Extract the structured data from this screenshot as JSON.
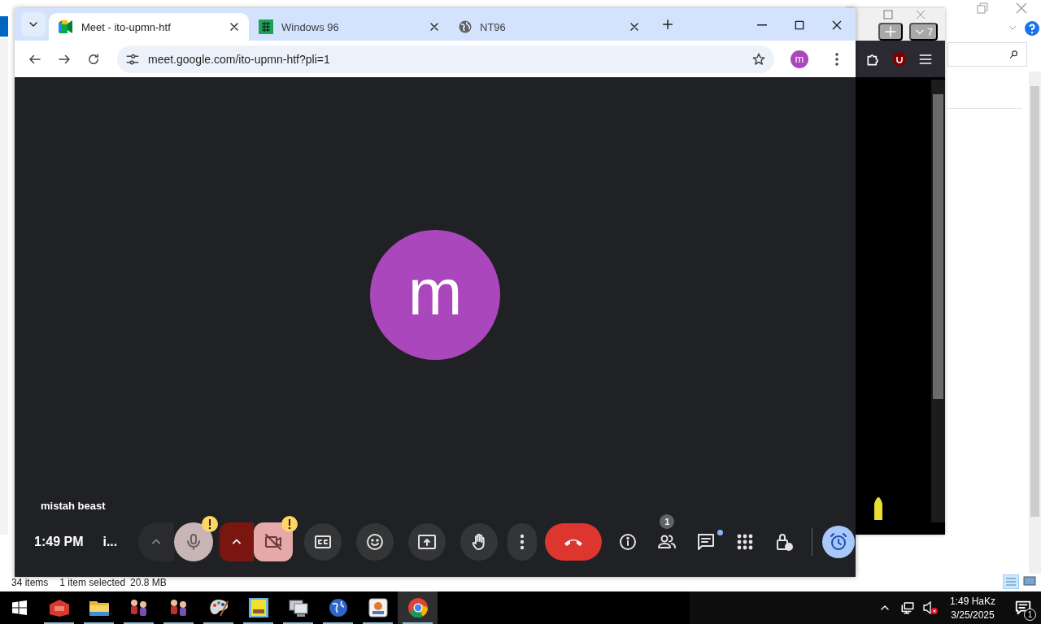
{
  "chrome_window": {
    "tabs": [
      {
        "title": "Meet - ito-upmn-htf",
        "kind": "meet",
        "selected": true
      },
      {
        "title": "Windows 96",
        "kind": "grid",
        "selected": false
      },
      {
        "title": "NT96",
        "kind": "globe",
        "selected": false
      }
    ],
    "url": "meet.google.com/ito-upmn-htf?pli=1",
    "profile_initial": "m"
  },
  "meet": {
    "avatar_initial": "m",
    "participant_name": "mistah beast",
    "time": "1:49 PM",
    "meeting_title": "i...",
    "controls": [
      {
        "kind": "audio_options",
        "warning": false,
        "unread": false
      },
      {
        "kind": "mic",
        "warning": true,
        "unread": false
      },
      {
        "kind": "video_options",
        "warning": false,
        "unread": false
      },
      {
        "kind": "camera",
        "warning": true,
        "unread": false
      },
      {
        "kind": "captions",
        "warning": false,
        "unread": false
      },
      {
        "kind": "reactions",
        "warning": false,
        "unread": false
      },
      {
        "kind": "present",
        "warning": false,
        "unread": false
      },
      {
        "kind": "raise_hand",
        "warning": false,
        "unread": false
      },
      {
        "kind": "more",
        "warning": false,
        "unread": false
      },
      {
        "kind": "end_call",
        "warning": false,
        "unread": false
      },
      {
        "kind": "info",
        "warning": false,
        "unread": false
      },
      {
        "kind": "people",
        "badge": "1",
        "warning": false,
        "unread": false
      },
      {
        "kind": "chat",
        "warning": false,
        "unread": true
      },
      {
        "kind": "activities",
        "warning": false,
        "unread": false
      },
      {
        "kind": "host_controls",
        "warning": false,
        "unread": false
      },
      {
        "kind": "timer",
        "warning": false,
        "unread": false
      }
    ]
  },
  "background_browser": {
    "tab_count": "7"
  },
  "explorer": {
    "item_count": "34 items",
    "selection": "1 item selected",
    "size": "20.8 MB"
  },
  "taskbar": {
    "apps": [
      {
        "kind": "toolbox",
        "selected": false
      },
      {
        "kind": "folder",
        "selected": false
      },
      {
        "kind": "figures",
        "selected": false
      },
      {
        "kind": "figures",
        "selected": false
      },
      {
        "kind": "palette",
        "selected": false
      },
      {
        "kind": "tile",
        "selected": false
      },
      {
        "kind": "computer",
        "selected": false
      },
      {
        "kind": "globe",
        "selected": false
      },
      {
        "kind": "installer",
        "selected": false
      },
      {
        "kind": "browser",
        "selected": true
      }
    ],
    "tray": {
      "time": "1:49 HaKz",
      "date": "3/25/2025",
      "notification_count": "1"
    }
  }
}
